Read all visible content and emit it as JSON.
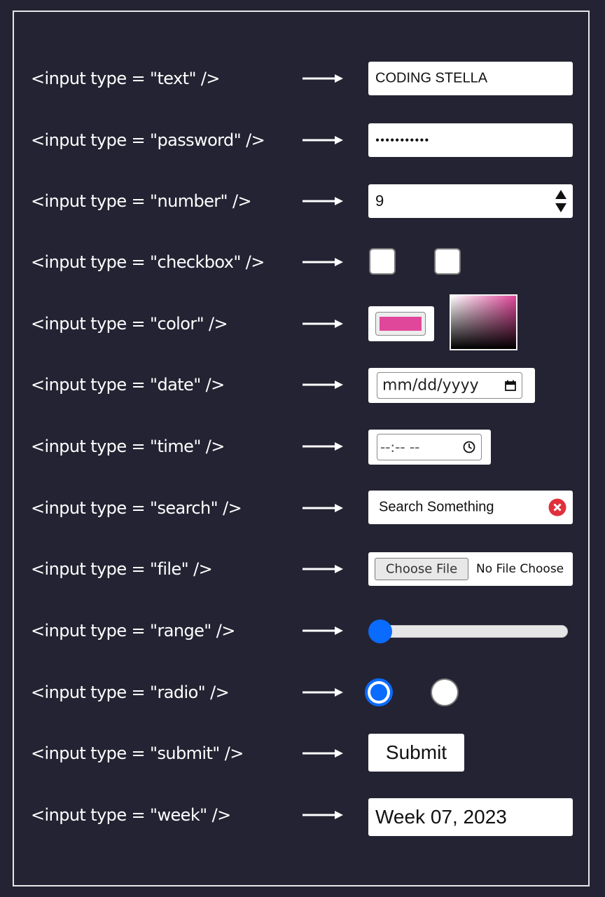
{
  "rows": [
    {
      "label": "<input type = \"text\" />"
    },
    {
      "label": "<input type = \"password\" />"
    },
    {
      "label": "<input type = \"number\" />"
    },
    {
      "label": "<input type = \"checkbox\" />"
    },
    {
      "label": "<input type = \"color\" />"
    },
    {
      "label": "<input type = \"date\" />"
    },
    {
      "label": "<input type = \"time\" />"
    },
    {
      "label": "<input type = \"search\" />"
    },
    {
      "label": "<input type = \"file\" />"
    },
    {
      "label": "<input type = \"range\" />"
    },
    {
      "label": "<input type = \"radio\" />"
    },
    {
      "label": "<input type = \"submit\" />"
    },
    {
      "label": "<input type = \"week\" />"
    }
  ],
  "controls": {
    "text_value": "CODING STELLA",
    "password_mask": "●●●●●●●●●●●",
    "number_value": "9",
    "checkboxes": [
      false,
      false
    ],
    "color_value": "#e0479a",
    "date_placeholder": "mm/dd/yyyy",
    "time_placeholder": "--:-- --",
    "search_value": "Search Something",
    "file_button": "Choose File",
    "file_status": "No File Choose",
    "range_value": 0,
    "radios": [
      true,
      false
    ],
    "submit_label": "Submit",
    "week_value": "Week 07, 2023"
  },
  "colors": {
    "background": "#242333",
    "accent": "#0a6cff",
    "clear_icon": "#e0303c"
  }
}
